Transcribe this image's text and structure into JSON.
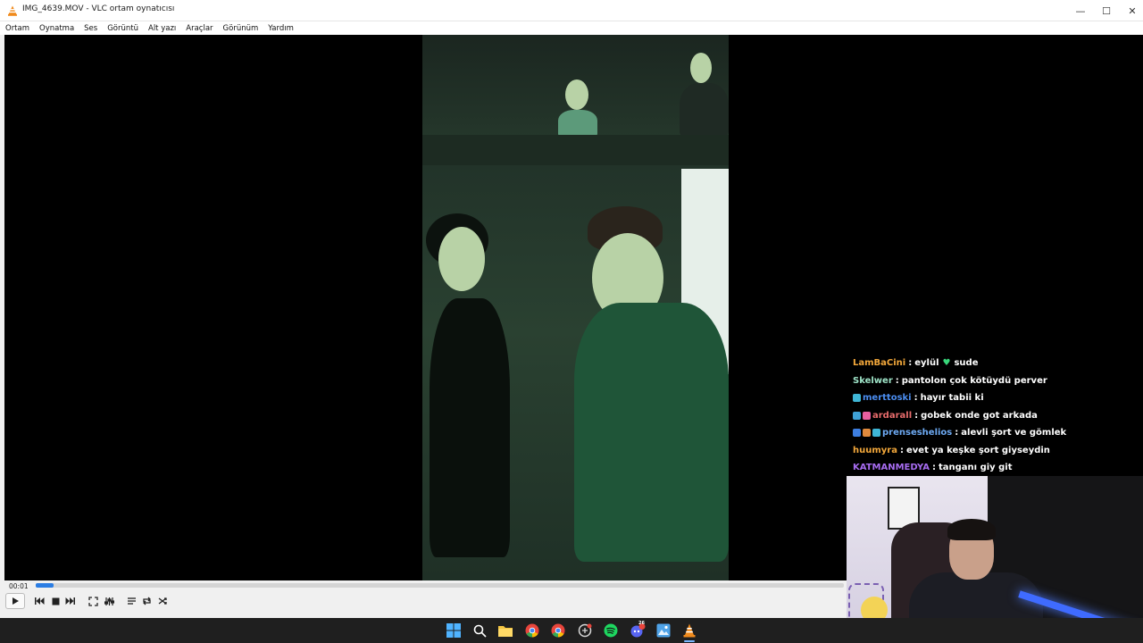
{
  "window": {
    "title": "IMG_4639.MOV - VLC ortam oynatıcısı",
    "minimize_glyph": "—",
    "maximize_glyph": "☐",
    "close_glyph": "✕"
  },
  "menu": {
    "items": [
      "Ortam",
      "Oynatma",
      "Ses",
      "Görüntü",
      "Alt yazı",
      "Araçlar",
      "Görünüm",
      "Yardım"
    ]
  },
  "player": {
    "elapsed": "00:01",
    "progress_fraction": 0.022,
    "icons": [
      "play-icon",
      "previous-icon",
      "stop-icon",
      "next-icon",
      "fullscreen-icon",
      "extended-settings-icon",
      "playlist-icon",
      "loop-icon",
      "shuffle-icon"
    ]
  },
  "chat": [
    {
      "user": "LamBaCini",
      "user_color": "#f3a83b",
      "badges": [],
      "msg_before": "eylül",
      "heart": true,
      "msg_after": "sude"
    },
    {
      "user": "Skelwer",
      "user_color": "#9ee3c7",
      "badges": [],
      "msg_before": "pantolon çok kötüydü perver",
      "heart": false,
      "msg_after": ""
    },
    {
      "user": "merttoski",
      "user_color": "#4b8df0",
      "badges": [
        "#3fb6d6"
      ],
      "msg_before": "hayır tabii ki",
      "heart": false,
      "msg_after": ""
    },
    {
      "user": "ardarall",
      "user_color": "#e86c6c",
      "badges": [
        "#3fa1d6",
        "#e85fa0"
      ],
      "msg_before": "gobek onde got arkada",
      "heart": false,
      "msg_after": ""
    },
    {
      "user": "prenseshelios",
      "user_color": "#6da9f2",
      "badges": [
        "#3d7ee0",
        "#e08a3d",
        "#3fb6d6"
      ],
      "msg_before": "alevli şort ve gömlek",
      "heart": false,
      "msg_after": ""
    },
    {
      "user": "huumyra",
      "user_color": "#f3a83b",
      "badges": [],
      "msg_before": "evet ya keşke şort giyseydin",
      "heart": false,
      "msg_after": ""
    },
    {
      "user": "KATMANMEDYA",
      "user_color": "#a76cf0",
      "badges": [],
      "msg_before": "tanganı giy git",
      "heart": false,
      "msg_after": ""
    }
  ],
  "taskbar": {
    "icons": [
      {
        "name": "windows-start-icon",
        "color": "#4fb3ff"
      },
      {
        "name": "search-icon",
        "color": "#ffffff"
      },
      {
        "name": "file-explorer-icon",
        "color": "#f4c542"
      },
      {
        "name": "chrome-icon",
        "color": "#e8453c"
      },
      {
        "name": "chrome-profile-icon",
        "color": "#e8453c"
      },
      {
        "name": "app-icon",
        "color": "#d8d8d8"
      },
      {
        "name": "spotify-icon",
        "color": "#1ed760"
      },
      {
        "name": "discord-icon",
        "color": "#5865f2"
      },
      {
        "name": "photos-icon",
        "color": "#4fa3e8"
      },
      {
        "name": "vlc-icon",
        "color": "#f08a1c"
      }
    ],
    "discord_badge": "26"
  }
}
